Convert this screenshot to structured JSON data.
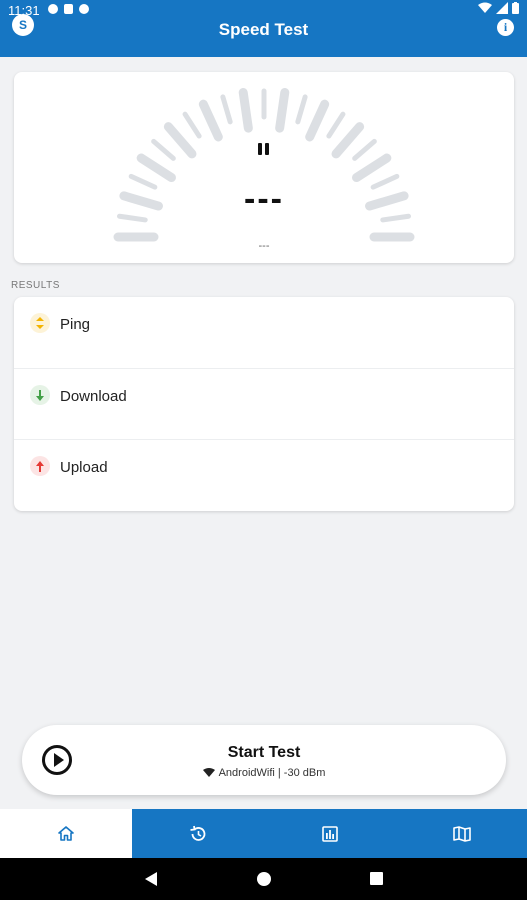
{
  "status_bar": {
    "time": "11:31"
  },
  "header": {
    "title": "Speed Test",
    "logo_glyph": "S",
    "info_glyph": "i"
  },
  "gauge": {
    "value": "---",
    "unit": "---",
    "state": "paused"
  },
  "results": {
    "section_label": "RESULTS",
    "items": [
      {
        "label": "Ping",
        "icon": "ping-icon",
        "color": "#f4b400",
        "bg": "#fdf3d7"
      },
      {
        "label": "Download",
        "icon": "download-arrow-icon",
        "color": "#43a047",
        "bg": "#e6f3e6"
      },
      {
        "label": "Upload",
        "icon": "upload-arrow-icon",
        "color": "#e53935",
        "bg": "#fce4e4"
      }
    ]
  },
  "start": {
    "label": "Start Test",
    "network": "AndroidWifi | -30 dBm"
  },
  "bottom_nav": {
    "items": [
      {
        "name": "home",
        "icon": "home-icon",
        "active": true
      },
      {
        "name": "history",
        "icon": "history-icon",
        "active": false
      },
      {
        "name": "stats",
        "icon": "bar-chart-icon",
        "active": false
      },
      {
        "name": "map",
        "icon": "map-icon",
        "active": false
      }
    ]
  },
  "colors": {
    "primary": "#1676c3",
    "background": "#f1f2f4"
  }
}
